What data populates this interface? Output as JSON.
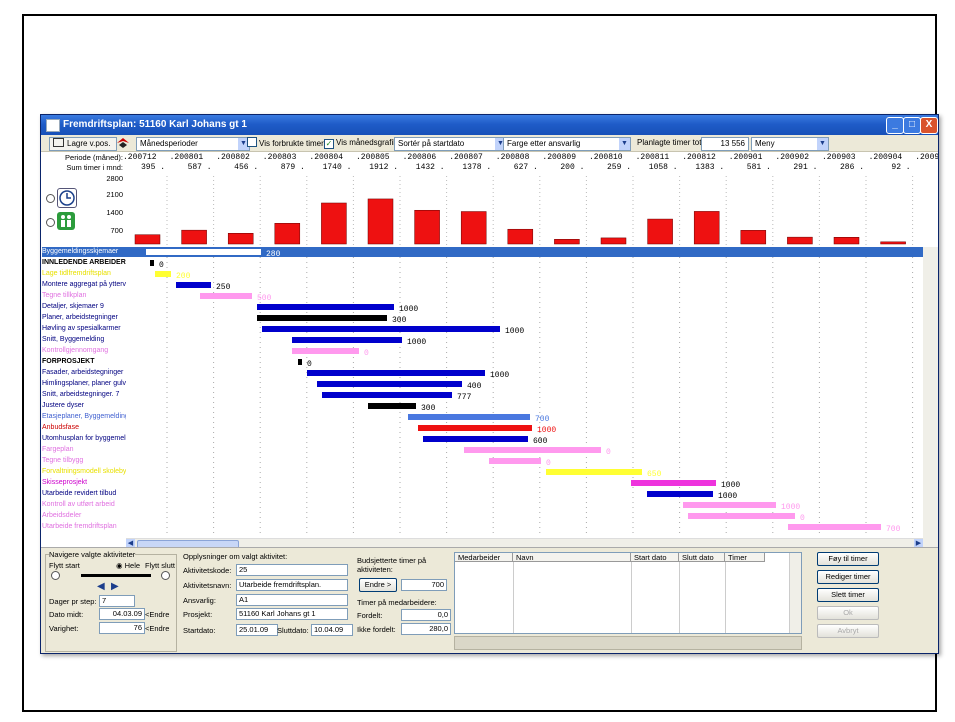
{
  "window": {
    "title": "Fremdriftsplan: 51160 Karl Johans gt 1",
    "min_glyph": "_",
    "max_glyph": "□",
    "close_glyph": "X"
  },
  "toolbar": {
    "save_label": "Lagre v.pos.",
    "period_select": "Månedsperioder",
    "show_used_hours": "Vis forbrukte timer",
    "show_month_graph": "Vis månedsgrafikk",
    "sort_label": "Sortér på startdato",
    "color_select": "Farge etter ansvarlig",
    "planned_label": "Planlagte timer totalt:",
    "planned_total": "13 556",
    "menu_select": "Meny",
    "show_used_checked": false,
    "show_month_checked": true
  },
  "header": {
    "period_label": "Periode (måned):",
    "sum_label": "Sum timer i mnd:",
    "periods": [
      ".200712",
      ".200801",
      ".200802",
      ".200803",
      ".200804",
      ".200805",
      ".200806",
      ".200807",
      ".200808",
      ".200809",
      ".200810",
      ".200811",
      ".200812",
      ".200901",
      ".200902",
      ".200903",
      ".200904",
      ".20090"
    ],
    "sums": [
      "395 .",
      "587 .",
      "456 .",
      "879 .",
      "1740 .",
      "1912 .",
      "1432 .",
      "1378 .",
      "627 .",
      "200 .",
      "259 .",
      "1058 .",
      "1383 .",
      "581 .",
      "291 .",
      "286 .",
      "92 .",
      ""
    ]
  },
  "chart_data": {
    "type": "bar",
    "categories": [
      "200712",
      "200801",
      "200802",
      "200803",
      "200804",
      "200805",
      "200806",
      "200807",
      "200808",
      "200809",
      "200810",
      "200811",
      "200812",
      "200901",
      "200902",
      "200903",
      "200904"
    ],
    "values": [
      395,
      587,
      456,
      879,
      1740,
      1912,
      1432,
      1378,
      627,
      200,
      259,
      1058,
      1383,
      581,
      291,
      286,
      92
    ],
    "yticks": [
      "2800",
      "2100",
      "1400",
      "700"
    ],
    "ylim": [
      0,
      2800
    ],
    "bar_color": "#ee1111"
  },
  "tasks": [
    {
      "name": "Byggemeldingsskjemaer",
      "color": "#ffffff",
      "bar_color": "#ffffff",
      "start": 0,
      "len": 115,
      "label": "280",
      "selected": true
    },
    {
      "name": "INNLEDENDE ARBEIDER",
      "color": "#000000",
      "bar_color": "#000000",
      "start": 4,
      "len": 4,
      "label": "0",
      "bold": true
    },
    {
      "name": "Lage tidlfremdriftsplan",
      "color": "#e8e000",
      "bar_color": "#ffff33",
      "start": 9,
      "len": 16,
      "label": "200"
    },
    {
      "name": "Montere aggregat på yttervegg",
      "color": "#000080",
      "bar_color": "#0000cc",
      "start": 30,
      "len": 35,
      "label": "250"
    },
    {
      "name": "Tegne tillkplan",
      "color": "#e070e0",
      "bar_color": "#ff99ee",
      "start": 54,
      "len": 52,
      "label": "500"
    },
    {
      "name": "Detaljer, skjemaer 9",
      "color": "#000080",
      "bar_color": "#0000cc",
      "start": 111,
      "len": 137,
      "label": "1000"
    },
    {
      "name": "Planer, arbeidstegninger",
      "color": "#000080",
      "bar_color": "#000000",
      "start": 111,
      "len": 130,
      "label": "300"
    },
    {
      "name": "Høvling av spesialkarmer",
      "color": "#000080",
      "bar_color": "#0000cc",
      "start": 116,
      "len": 238,
      "label": "1000"
    },
    {
      "name": "Snitt, Byggemelding",
      "color": "#000080",
      "bar_color": "#0000cc",
      "start": 146,
      "len": 110,
      "label": "1000"
    },
    {
      "name": "Kontrollgjennomgang",
      "color": "#e070e0",
      "bar_color": "#ff99ee",
      "start": 146,
      "len": 67,
      "label": "0"
    },
    {
      "name": "FORPROSJEKT",
      "color": "#000000",
      "bar_color": "#000000",
      "start": 152,
      "len": 4,
      "label": "0",
      "bold": true
    },
    {
      "name": "Fasader, arbeidstegninger",
      "color": "#000080",
      "bar_color": "#0000cc",
      "start": 161,
      "len": 178,
      "label": "1000"
    },
    {
      "name": "Himlingsplaner, planer gulv",
      "color": "#000080",
      "bar_color": "#0000cc",
      "start": 171,
      "len": 145,
      "label": "400"
    },
    {
      "name": "Snitt, arbeidstegninger. 7",
      "color": "#000080",
      "bar_color": "#0000cc",
      "start": 176,
      "len": 130,
      "label": "777"
    },
    {
      "name": "Justere dyser",
      "color": "#000080",
      "bar_color": "#000000",
      "start": 222,
      "len": 48,
      "label": "300"
    },
    {
      "name": "Etasjeplaner, Byggemelding",
      "color": "#4060d0",
      "bar_color": "#4a78e0",
      "start": 262,
      "len": 122,
      "label": "700"
    },
    {
      "name": "Anbudsfase",
      "color": "#cc0000",
      "bar_color": "#ee1111",
      "start": 272,
      "len": 114,
      "label": "1000"
    },
    {
      "name": "Utomhusplan for byggemeld",
      "color": "#000080",
      "bar_color": "#0000cc",
      "start": 277,
      "len": 105,
      "label": "600"
    },
    {
      "name": "Fargeplan",
      "color": "#e070e0",
      "bar_color": "#ff99ee",
      "start": 318,
      "len": 137,
      "label": "0"
    },
    {
      "name": "Tegne tilbygg",
      "color": "#e070e0",
      "bar_color": "#ff99ee",
      "start": 343,
      "len": 52,
      "label": "0"
    },
    {
      "name": "Forvaltningsmodell skolebygg",
      "color": "#e8e000",
      "bar_color": "#ffff33",
      "start": 400,
      "len": 96,
      "label": "650"
    },
    {
      "name": "Skisseprosjekt",
      "color": "#cc00cc",
      "bar_color": "#ee33dd",
      "start": 485,
      "len": 85,
      "label": "1000"
    },
    {
      "name": "Utarbeide revidert tilbud",
      "color": "#000080",
      "bar_color": "#0000cc",
      "start": 501,
      "len": 66,
      "label": "1000"
    },
    {
      "name": "Kontroll av utført arbeid",
      "color": "#e070e0",
      "bar_color": "#ff99ee",
      "start": 537,
      "len": 93,
      "label": "1000"
    },
    {
      "name": "Arbeidsdeler",
      "color": "#e070e0",
      "bar_color": "#ff99ee",
      "start": 542,
      "len": 107,
      "label": "0"
    },
    {
      "name": "Utarbeide fremdriftsplan",
      "color": "#e070e0",
      "bar_color": "#ff99ee",
      "start": 642,
      "len": 93,
      "label": "700"
    }
  ],
  "nav": {
    "group_title": "Navigere valgte aktiviteter",
    "move_start": "Flytt start",
    "whole": "Hele",
    "move_end": "Flytt slutt",
    "days_label": "Dager pr step:",
    "days_value": "7",
    "date_mid_label": "Dato midt:",
    "date_mid_value": "04.03.09",
    "duration_label": "Varighet:",
    "duration_value": "76",
    "change_btn": "<Endre"
  },
  "info": {
    "title": "Opplysninger om valgt aktivitet:",
    "code_label": "Aktivitetskode:",
    "code_value": "25",
    "name_label": "Aktivitetsnavn:",
    "name_value": "Utarbeide fremdriftsplan.",
    "resp_label": "Ansvarlig:",
    "resp_value": "A1",
    "project_label": "Prosjekt:",
    "project_value": "51160  Karl Johans gt 1",
    "start_label": "Startdato:",
    "start_value": "25.01.09",
    "end_label": "Sluttdato:",
    "end_value": "10.04.09"
  },
  "budget": {
    "title": "Budsjetterte timer på aktiviteten:",
    "change_btn": "Endre >",
    "value": "700",
    "employees_title": "Timer på medarbeidere:",
    "assigned_label": "Fordelt:",
    "assigned_value": "0,0",
    "unassigned_label": "Ikke fordelt:",
    "unassigned_value": "280,0"
  },
  "table": {
    "columns": [
      "Medarbeider",
      "Navn",
      "Start dato",
      "Slutt dato",
      "Timer"
    ]
  },
  "buttons": {
    "add": "Føy til timer",
    "edit": "Rediger timer",
    "delete": "Slett timer",
    "ok": "Ok",
    "cancel": "Avbryt"
  }
}
